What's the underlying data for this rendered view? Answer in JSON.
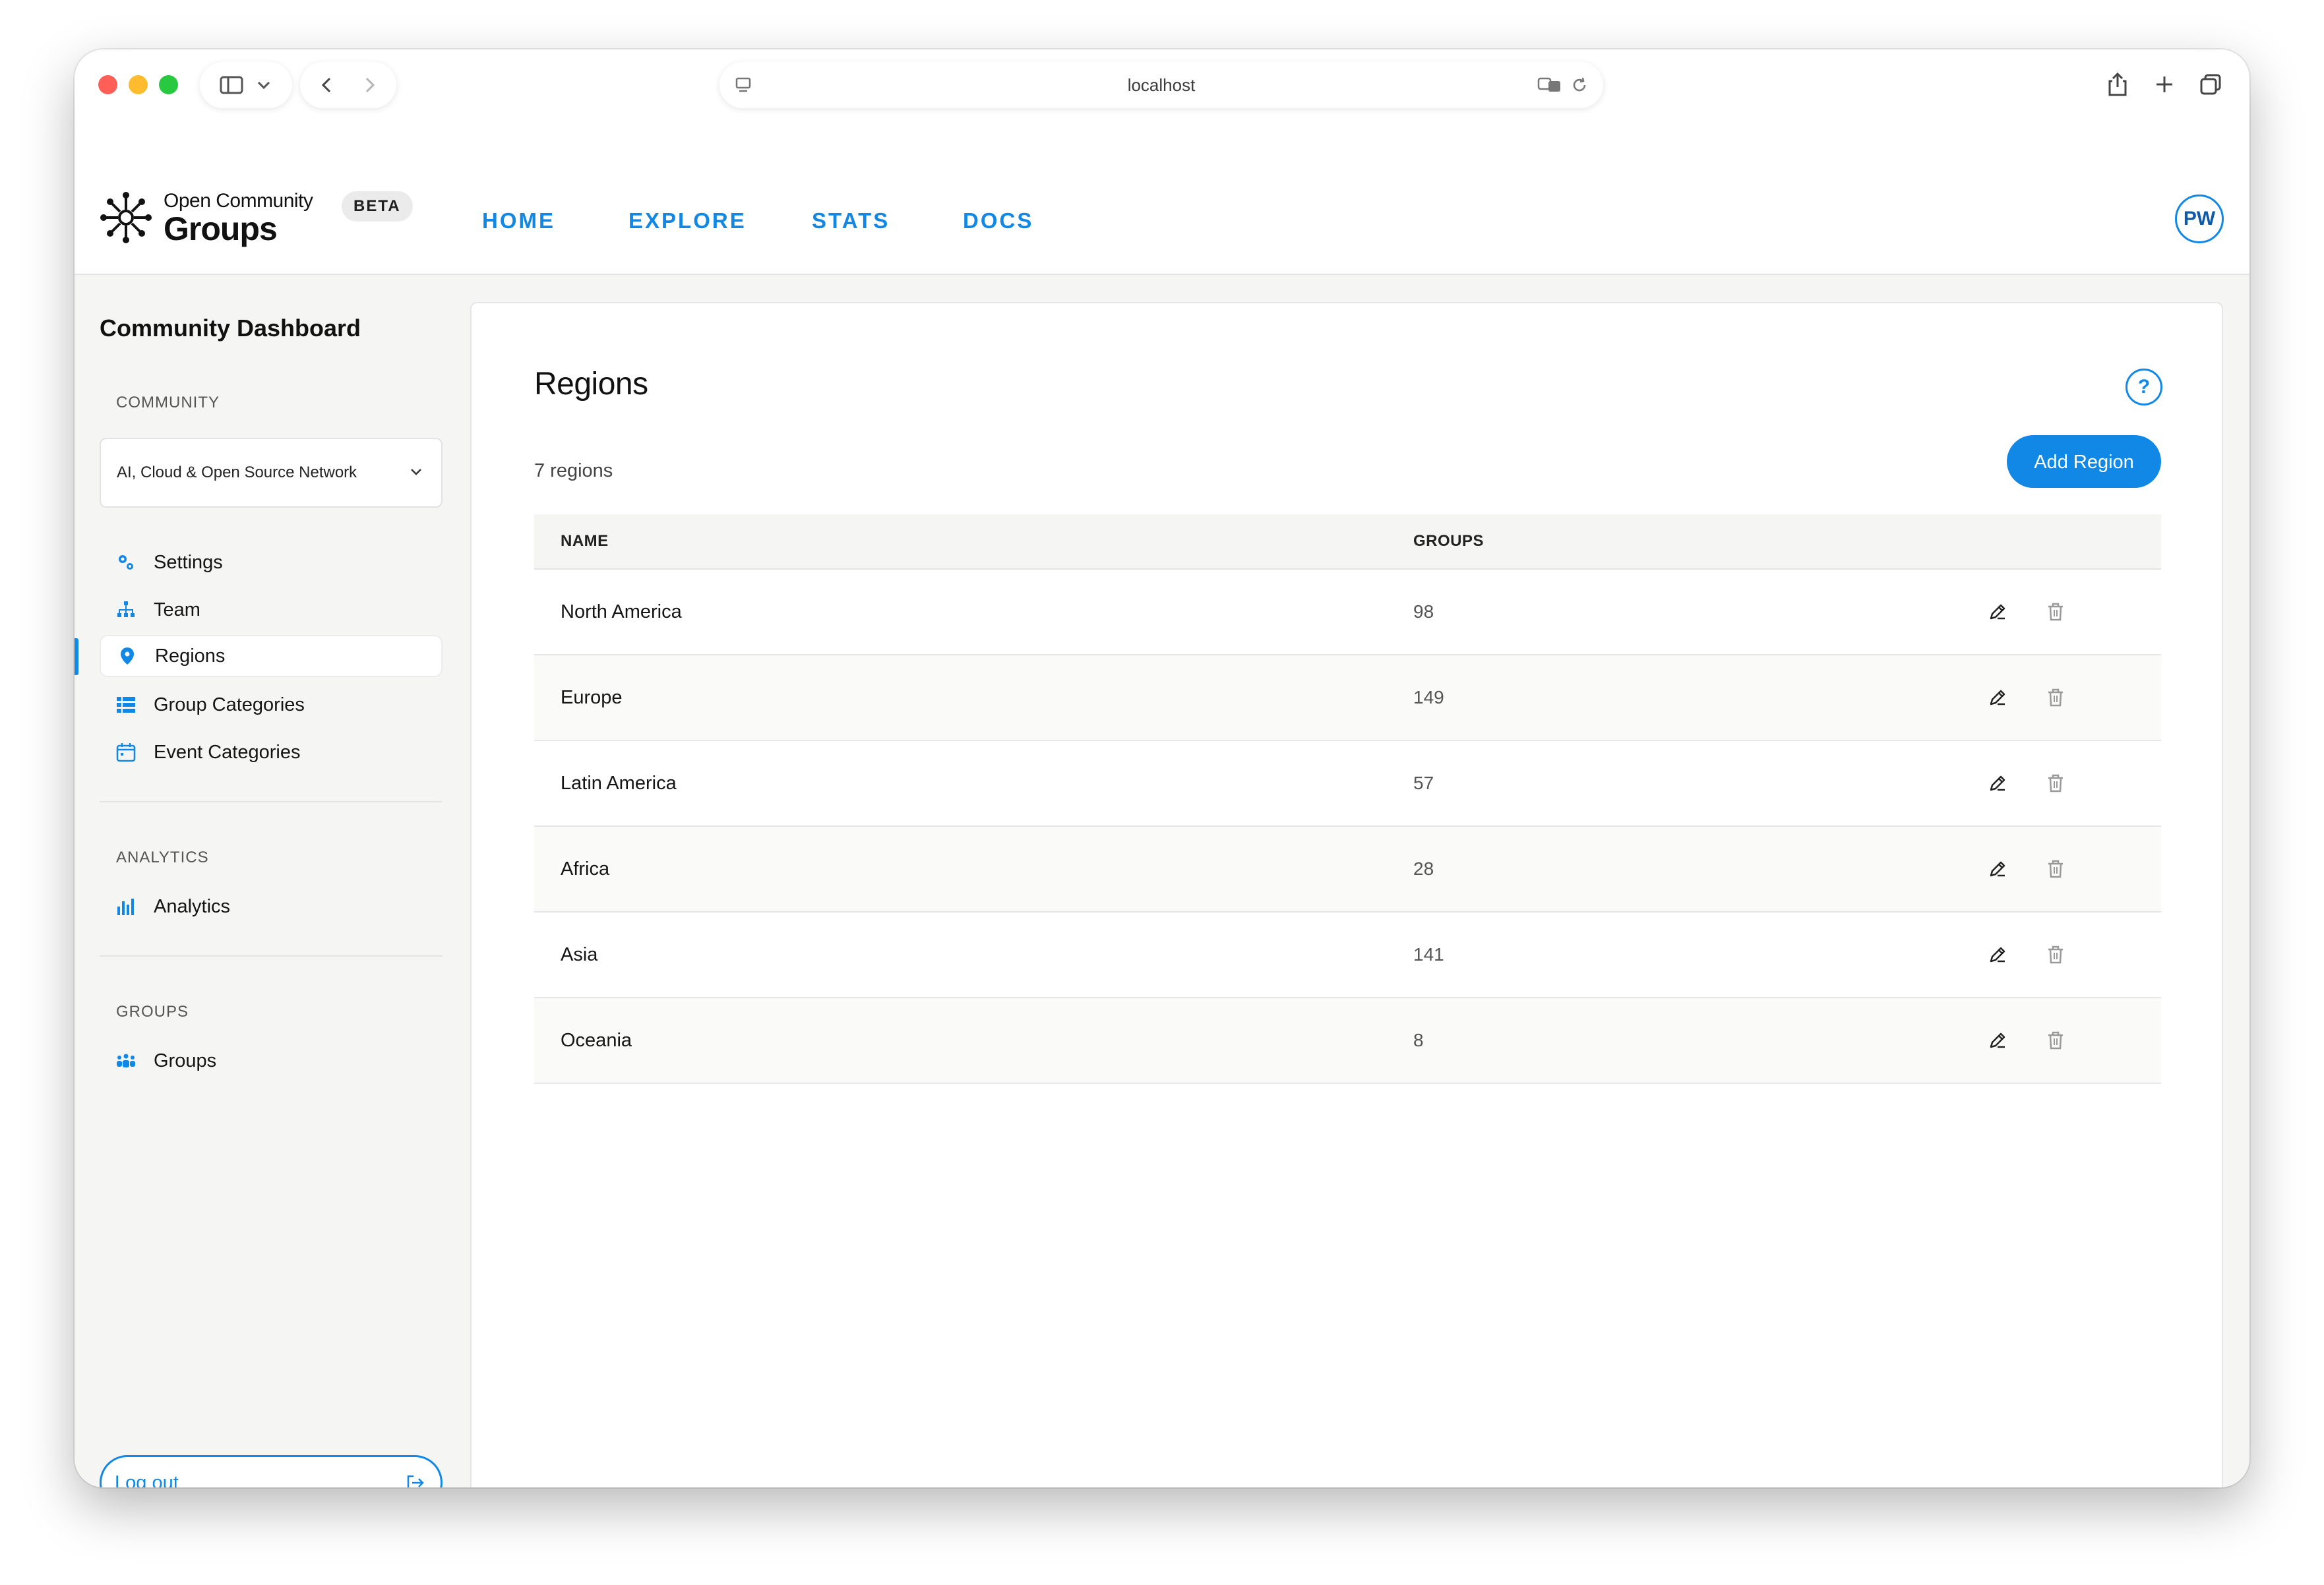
{
  "browser": {
    "url": "localhost"
  },
  "app": {
    "logo_top": "Open Community",
    "logo_bottom": "Groups",
    "beta": "BETA",
    "nav": [
      "HOME",
      "EXPLORE",
      "STATS",
      "DOCS"
    ],
    "avatar_initials": "PW",
    "accent_color": "#1188e6"
  },
  "sidebar": {
    "title": "Community Dashboard",
    "community_section": "COMMUNITY",
    "community_selected": "AI, Cloud & Open Source Network",
    "items": [
      {
        "label": "Settings",
        "icon": "gears-icon"
      },
      {
        "label": "Team",
        "icon": "org-chart-icon"
      },
      {
        "label": "Regions",
        "icon": "map-pin-icon",
        "active": true
      },
      {
        "label": "Group Categories",
        "icon": "list-icon"
      },
      {
        "label": "Event Categories",
        "icon": "calendar-icon"
      }
    ],
    "analytics_section": "ANALYTICS",
    "analytics_item": "Analytics",
    "groups_section": "GROUPS",
    "groups_item": "Groups",
    "logout": "Log out"
  },
  "main": {
    "title": "Regions",
    "help": "?",
    "count": "7 regions",
    "add_button": "Add Region",
    "columns": [
      "NAME",
      "GROUPS"
    ],
    "rows": [
      {
        "name": "North America",
        "groups": "98"
      },
      {
        "name": "Europe",
        "groups": "149"
      },
      {
        "name": "Latin America",
        "groups": "57"
      },
      {
        "name": "Africa",
        "groups": "28"
      },
      {
        "name": "Asia",
        "groups": "141"
      },
      {
        "name": "Oceania",
        "groups": "8"
      }
    ]
  }
}
